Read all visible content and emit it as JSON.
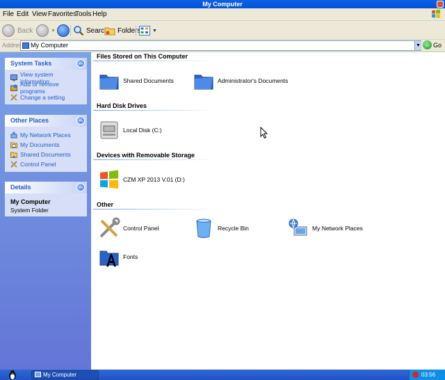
{
  "window": {
    "title": "My Computer"
  },
  "menu": [
    "File",
    "Edit",
    "View",
    "Favorites",
    "Tools",
    "Help"
  ],
  "toolbar": {
    "back_label": "Back",
    "search_label": "Search",
    "folders_label": "Folders"
  },
  "address": {
    "label": "Address",
    "value": "My Computer",
    "go_label": "Go"
  },
  "sidebar": {
    "system_tasks": {
      "title": "System Tasks",
      "items": [
        {
          "label": "View system information",
          "icon": "system-info-icon"
        },
        {
          "label": "Add or remove programs",
          "icon": "add-remove-icon"
        },
        {
          "label": "Change a setting",
          "icon": "control-panel-icon"
        }
      ]
    },
    "other_places": {
      "title": "Other Places",
      "items": [
        {
          "label": "My Network Places",
          "icon": "network-icon"
        },
        {
          "label": "My Documents",
          "icon": "documents-icon"
        },
        {
          "label": "Shared Documents",
          "icon": "shared-folder-icon"
        },
        {
          "label": "Control Panel",
          "icon": "control-panel-icon"
        }
      ]
    },
    "details": {
      "title": "Details",
      "name": "My Computer",
      "subtitle": "System Folder"
    }
  },
  "groups": {
    "files": {
      "title": "Files Stored on This Computer",
      "items": [
        {
          "label": "Shared Documents",
          "icon": "folder-icon"
        },
        {
          "label": "Administrator's Documents",
          "icon": "folder-icon"
        }
      ]
    },
    "hard_disks": {
      "title": "Hard Disk Drives",
      "items": [
        {
          "label": "Local Disk (C:)",
          "icon": "hard-disk-icon"
        }
      ]
    },
    "removable": {
      "title": "Devices with Removable Storage",
      "items": [
        {
          "label": "CZM XP 2013 V.01 (D:)",
          "icon": "windows-cd-icon"
        }
      ]
    },
    "other": {
      "title": "Other",
      "items": [
        {
          "label": "Control Panel",
          "icon": "control-panel-icon"
        },
        {
          "label": "Recycle Bin",
          "icon": "recycle-bin-icon"
        },
        {
          "label": "My Network Places",
          "icon": "network-icon"
        },
        {
          "label": "Fonts",
          "icon": "fonts-folder-icon"
        }
      ]
    }
  },
  "taskbar": {
    "window_button": "My Computer",
    "clock": "03:56"
  },
  "colors": {
    "title_bar": "#0451d6",
    "sidebar_top": "#7ba2e7",
    "sidebar_bottom": "#6375d6",
    "link_blue": "#215dc6",
    "taskbar": "#245edb"
  }
}
